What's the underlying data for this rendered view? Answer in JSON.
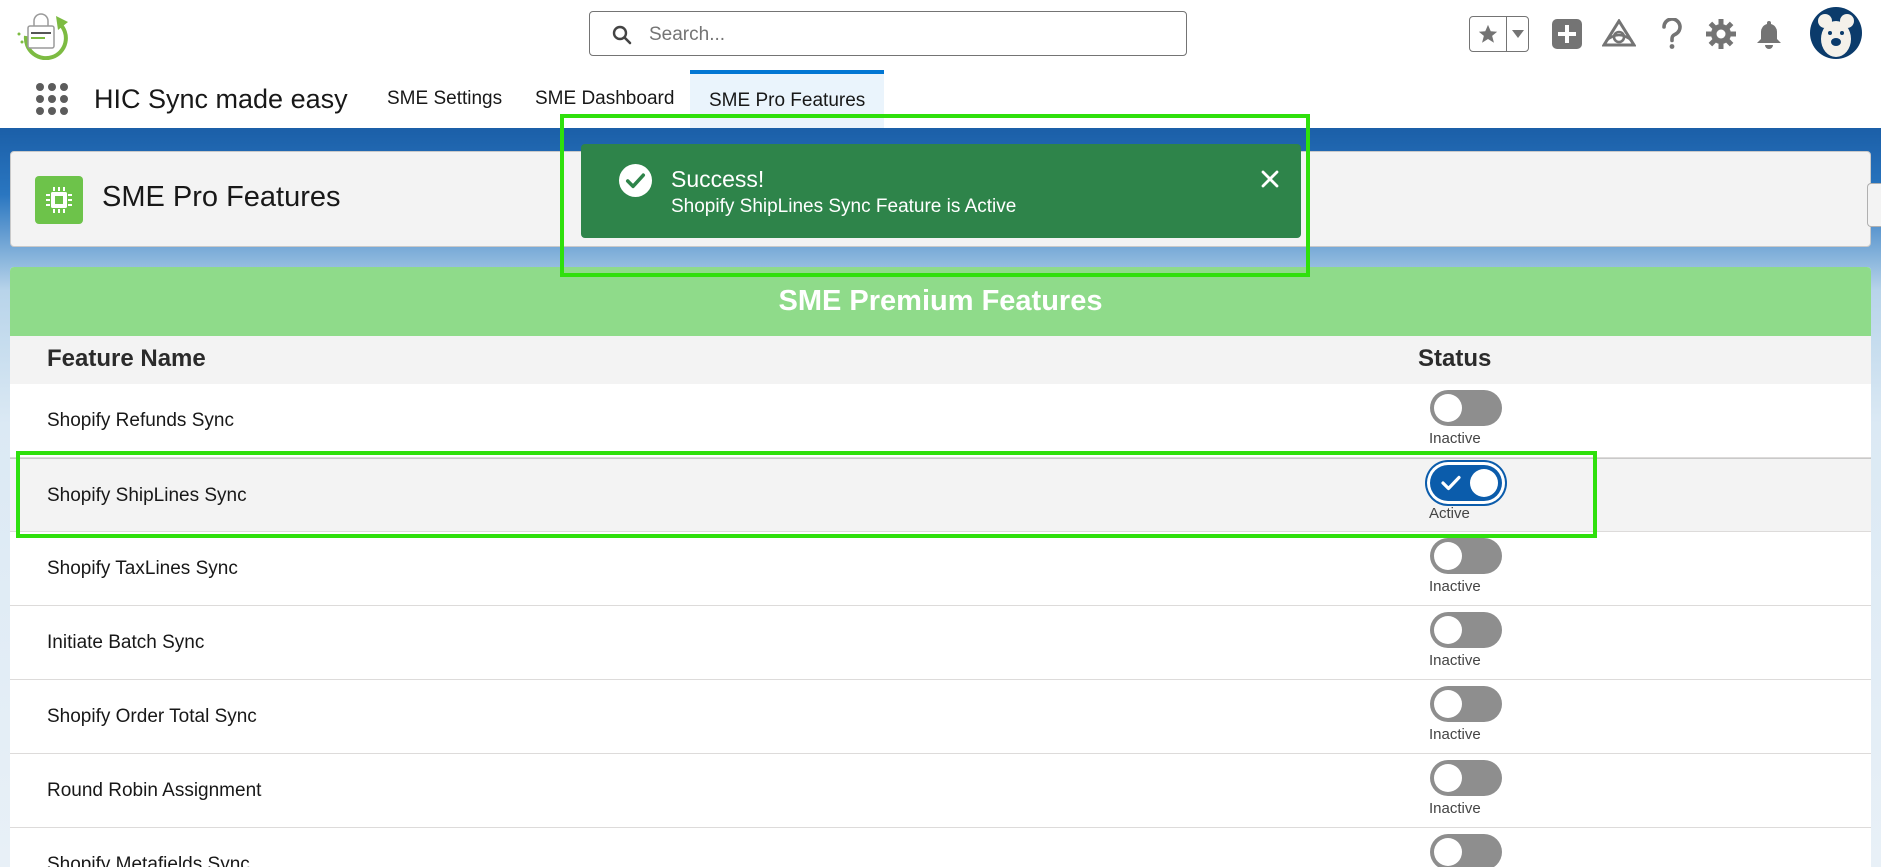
{
  "header": {
    "search_placeholder": "Search...",
    "icons": [
      "favorites-star-icon",
      "favorites-caret-icon",
      "global-add-icon",
      "trailhead-icon",
      "help-icon",
      "setup-gear-icon",
      "notifications-bell-icon"
    ]
  },
  "nav": {
    "app_name": "HIC Sync made easy",
    "tabs": [
      {
        "label": "SME Settings",
        "active": false
      },
      {
        "label": "SME Dashboard",
        "active": false
      },
      {
        "label": "SME Pro Features",
        "active": true
      }
    ]
  },
  "page": {
    "title": "SME Pro Features"
  },
  "toast": {
    "title": "Success!",
    "message": "Shopify ShipLines Sync Feature is Active",
    "color": "#2e844a"
  },
  "features": {
    "banner": "SME Premium Features",
    "columns": {
      "name": "Feature Name",
      "status": "Status"
    },
    "rows": [
      {
        "name": "Shopify Refunds Sync",
        "status": "Inactive",
        "active": false
      },
      {
        "name": "Shopify ShipLines Sync",
        "status": "Active",
        "active": true
      },
      {
        "name": "Shopify TaxLines Sync",
        "status": "Inactive",
        "active": false
      },
      {
        "name": "Initiate Batch Sync",
        "status": "Inactive",
        "active": false
      },
      {
        "name": "Shopify Order Total Sync",
        "status": "Inactive",
        "active": false
      },
      {
        "name": "Round Robin Assignment",
        "status": "Inactive",
        "active": false
      },
      {
        "name": "Shopify Metafields Sync",
        "status": "",
        "active": false
      }
    ]
  },
  "colors": {
    "brand_blue": "#0176d3",
    "toggle_on": "#0b5cab",
    "toggle_off": "#8e8e8e",
    "banner_green": "#8fdb8a",
    "highlight": "#2fe00c"
  }
}
